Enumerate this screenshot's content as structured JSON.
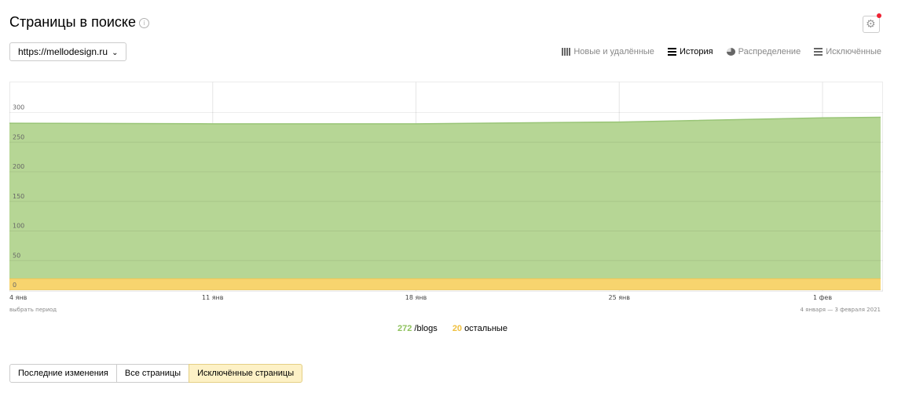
{
  "header": {
    "title": "Страницы в поиске",
    "info_icon": "info-icon",
    "settings_icon": "gear-icon"
  },
  "site_selector": {
    "value": "https://mellodesign.ru"
  },
  "view_tabs": [
    {
      "label": "Новые и удалённые",
      "icon": "bars-icon",
      "active": false
    },
    {
      "label": "История",
      "icon": "waves-icon",
      "active": true
    },
    {
      "label": "Распределение",
      "icon": "pie-icon",
      "active": false
    },
    {
      "label": "Исключённые",
      "icon": "waves-icon",
      "active": false
    }
  ],
  "chart_data": {
    "type": "area",
    "stacked": true,
    "x": [
      "2021-01-04",
      "2021-01-11",
      "2021-01-18",
      "2021-01-25",
      "2021-02-01",
      "2021-02-03"
    ],
    "x_tick_labels": [
      "4 янв",
      "11 янв",
      "18 янв",
      "25 янв",
      "1 фев"
    ],
    "y_ticks": [
      0,
      50,
      100,
      150,
      200,
      250,
      300
    ],
    "ylim": [
      0,
      330
    ],
    "grid": true,
    "series": [
      {
        "name": "остальные",
        "color": "#f7d46e",
        "values": [
          20,
          20,
          20,
          20,
          20,
          20
        ]
      },
      {
        "name": "/blogs",
        "color": "#b6d695",
        "values": [
          262,
          261,
          261,
          264,
          271,
          272
        ]
      }
    ]
  },
  "period": {
    "pick_label": "выбрать период",
    "range": "4 января — 3 февраля 2021"
  },
  "legend": [
    {
      "value": "272",
      "label": "/blogs",
      "color": "#8fc25d"
    },
    {
      "value": "20",
      "label": "остальные",
      "color": "#f0c040"
    }
  ],
  "bottom_tabs": [
    {
      "label": "Последние изменения",
      "active": false
    },
    {
      "label": "Все страницы",
      "active": false
    },
    {
      "label": "Исключённые страницы",
      "active": true
    }
  ]
}
